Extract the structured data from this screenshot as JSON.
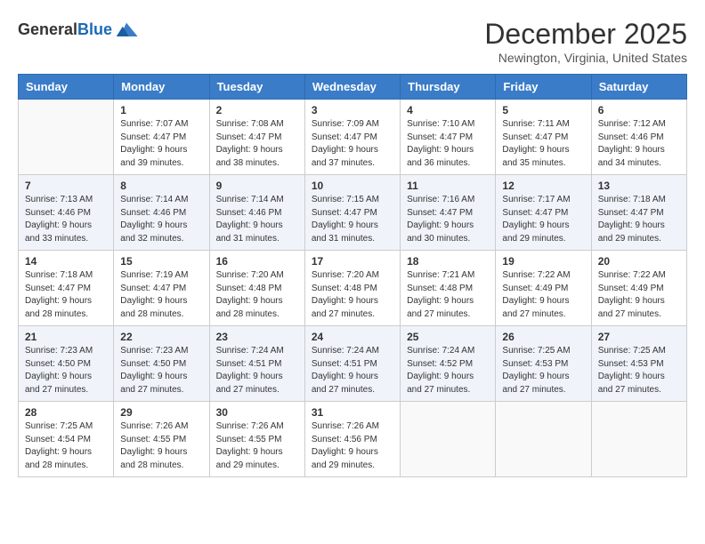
{
  "logo": {
    "general": "General",
    "blue": "Blue"
  },
  "title": "December 2025",
  "location": "Newington, Virginia, United States",
  "days_of_week": [
    "Sunday",
    "Monday",
    "Tuesday",
    "Wednesday",
    "Thursday",
    "Friday",
    "Saturday"
  ],
  "weeks": [
    [
      {
        "day": "",
        "info": ""
      },
      {
        "day": "1",
        "info": "Sunrise: 7:07 AM\nSunset: 4:47 PM\nDaylight: 9 hours\nand 39 minutes."
      },
      {
        "day": "2",
        "info": "Sunrise: 7:08 AM\nSunset: 4:47 PM\nDaylight: 9 hours\nand 38 minutes."
      },
      {
        "day": "3",
        "info": "Sunrise: 7:09 AM\nSunset: 4:47 PM\nDaylight: 9 hours\nand 37 minutes."
      },
      {
        "day": "4",
        "info": "Sunrise: 7:10 AM\nSunset: 4:47 PM\nDaylight: 9 hours\nand 36 minutes."
      },
      {
        "day": "5",
        "info": "Sunrise: 7:11 AM\nSunset: 4:47 PM\nDaylight: 9 hours\nand 35 minutes."
      },
      {
        "day": "6",
        "info": "Sunrise: 7:12 AM\nSunset: 4:46 PM\nDaylight: 9 hours\nand 34 minutes."
      }
    ],
    [
      {
        "day": "7",
        "info": "Sunrise: 7:13 AM\nSunset: 4:46 PM\nDaylight: 9 hours\nand 33 minutes."
      },
      {
        "day": "8",
        "info": "Sunrise: 7:14 AM\nSunset: 4:46 PM\nDaylight: 9 hours\nand 32 minutes."
      },
      {
        "day": "9",
        "info": "Sunrise: 7:14 AM\nSunset: 4:46 PM\nDaylight: 9 hours\nand 31 minutes."
      },
      {
        "day": "10",
        "info": "Sunrise: 7:15 AM\nSunset: 4:47 PM\nDaylight: 9 hours\nand 31 minutes."
      },
      {
        "day": "11",
        "info": "Sunrise: 7:16 AM\nSunset: 4:47 PM\nDaylight: 9 hours\nand 30 minutes."
      },
      {
        "day": "12",
        "info": "Sunrise: 7:17 AM\nSunset: 4:47 PM\nDaylight: 9 hours\nand 29 minutes."
      },
      {
        "day": "13",
        "info": "Sunrise: 7:18 AM\nSunset: 4:47 PM\nDaylight: 9 hours\nand 29 minutes."
      }
    ],
    [
      {
        "day": "14",
        "info": "Sunrise: 7:18 AM\nSunset: 4:47 PM\nDaylight: 9 hours\nand 28 minutes."
      },
      {
        "day": "15",
        "info": "Sunrise: 7:19 AM\nSunset: 4:47 PM\nDaylight: 9 hours\nand 28 minutes."
      },
      {
        "day": "16",
        "info": "Sunrise: 7:20 AM\nSunset: 4:48 PM\nDaylight: 9 hours\nand 28 minutes."
      },
      {
        "day": "17",
        "info": "Sunrise: 7:20 AM\nSunset: 4:48 PM\nDaylight: 9 hours\nand 27 minutes."
      },
      {
        "day": "18",
        "info": "Sunrise: 7:21 AM\nSunset: 4:48 PM\nDaylight: 9 hours\nand 27 minutes."
      },
      {
        "day": "19",
        "info": "Sunrise: 7:22 AM\nSunset: 4:49 PM\nDaylight: 9 hours\nand 27 minutes."
      },
      {
        "day": "20",
        "info": "Sunrise: 7:22 AM\nSunset: 4:49 PM\nDaylight: 9 hours\nand 27 minutes."
      }
    ],
    [
      {
        "day": "21",
        "info": "Sunrise: 7:23 AM\nSunset: 4:50 PM\nDaylight: 9 hours\nand 27 minutes."
      },
      {
        "day": "22",
        "info": "Sunrise: 7:23 AM\nSunset: 4:50 PM\nDaylight: 9 hours\nand 27 minutes."
      },
      {
        "day": "23",
        "info": "Sunrise: 7:24 AM\nSunset: 4:51 PM\nDaylight: 9 hours\nand 27 minutes."
      },
      {
        "day": "24",
        "info": "Sunrise: 7:24 AM\nSunset: 4:51 PM\nDaylight: 9 hours\nand 27 minutes."
      },
      {
        "day": "25",
        "info": "Sunrise: 7:24 AM\nSunset: 4:52 PM\nDaylight: 9 hours\nand 27 minutes."
      },
      {
        "day": "26",
        "info": "Sunrise: 7:25 AM\nSunset: 4:53 PM\nDaylight: 9 hours\nand 27 minutes."
      },
      {
        "day": "27",
        "info": "Sunrise: 7:25 AM\nSunset: 4:53 PM\nDaylight: 9 hours\nand 27 minutes."
      }
    ],
    [
      {
        "day": "28",
        "info": "Sunrise: 7:25 AM\nSunset: 4:54 PM\nDaylight: 9 hours\nand 28 minutes."
      },
      {
        "day": "29",
        "info": "Sunrise: 7:26 AM\nSunset: 4:55 PM\nDaylight: 9 hours\nand 28 minutes."
      },
      {
        "day": "30",
        "info": "Sunrise: 7:26 AM\nSunset: 4:55 PM\nDaylight: 9 hours\nand 29 minutes."
      },
      {
        "day": "31",
        "info": "Sunrise: 7:26 AM\nSunset: 4:56 PM\nDaylight: 9 hours\nand 29 minutes."
      },
      {
        "day": "",
        "info": ""
      },
      {
        "day": "",
        "info": ""
      },
      {
        "day": "",
        "info": ""
      }
    ]
  ]
}
